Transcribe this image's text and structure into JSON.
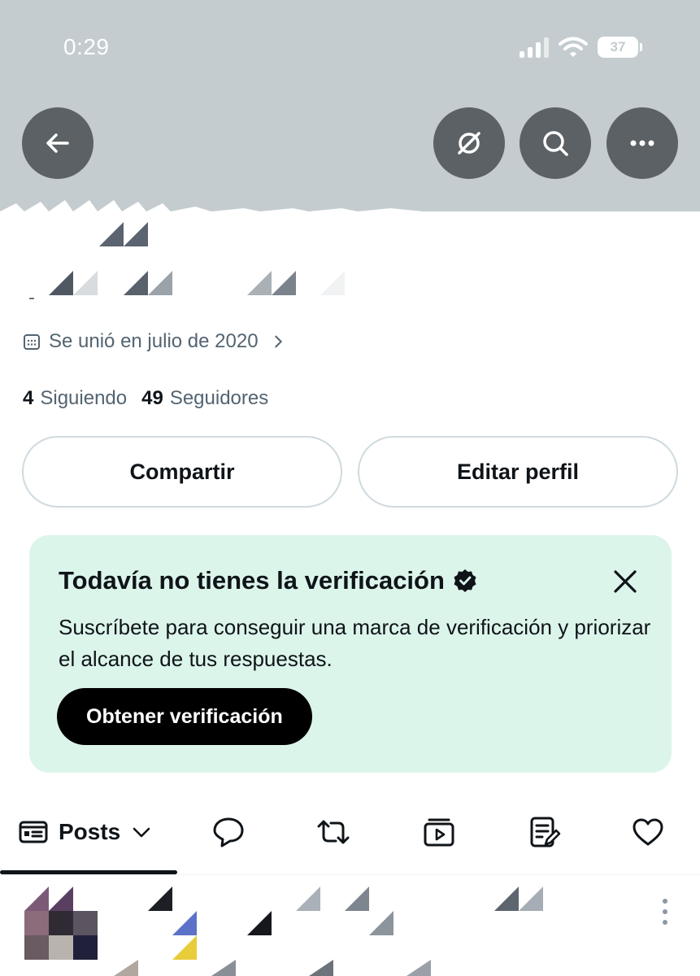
{
  "status_bar": {
    "time": "0:29",
    "battery": "37"
  },
  "header_icons": {
    "back": "arrow-left-icon",
    "grok": "grok-icon",
    "search": "search-icon",
    "more": "more-horizontal-icon"
  },
  "profile": {
    "joined": "Se unió en julio de 2020",
    "following_count": "4",
    "following_label": "Siguiendo",
    "followers_count": "49",
    "followers_label": "Seguidores"
  },
  "actions": {
    "share": "Compartir",
    "edit": "Editar perfil"
  },
  "verification_card": {
    "title": "Todavía no tienes la verificación",
    "body": "Suscríbete para conseguir una marca de verificación y priorizar el alcance de tus respuestas.",
    "cta": "Obtener verificación"
  },
  "tabs": {
    "active_label": "Posts",
    "items": [
      "posts-icon",
      "replies-icon",
      "reposts-icon",
      "media-icon",
      "articles-icon",
      "likes-icon"
    ]
  },
  "colors": {
    "banner": "#c4ccd0",
    "card": "#dcf5ea",
    "muted": "#536471",
    "text": "#0f1419"
  }
}
